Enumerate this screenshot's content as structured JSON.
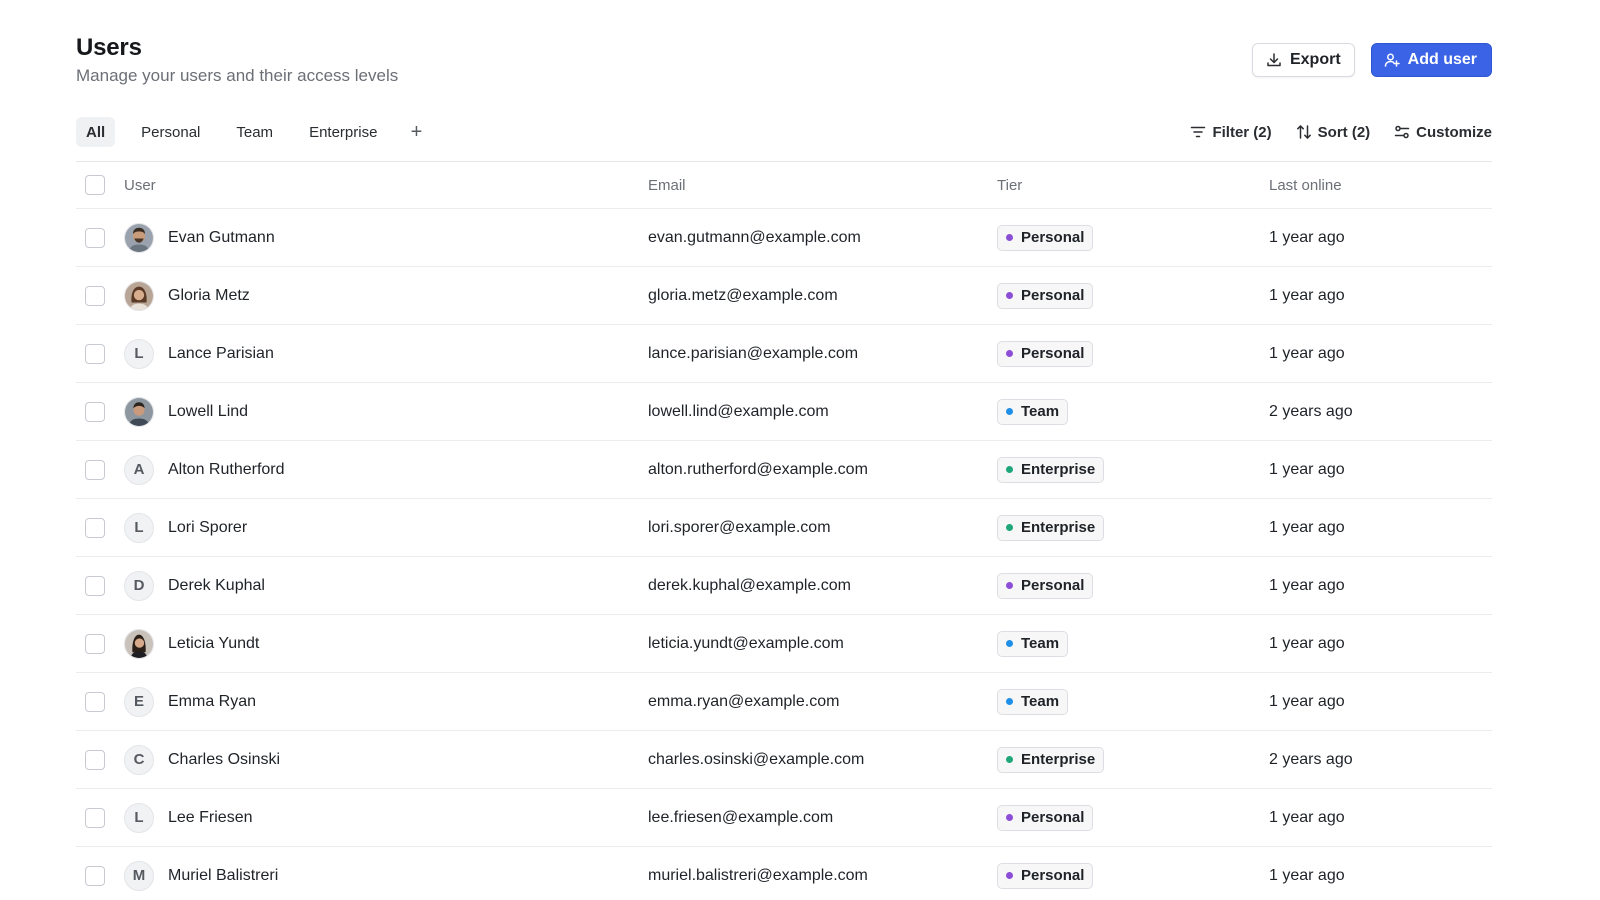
{
  "header": {
    "title": "Users",
    "subtitle": "Manage your users and their access levels",
    "export_label": "Export",
    "add_user_label": "Add user"
  },
  "tabs": [
    {
      "label": "All",
      "active": true
    },
    {
      "label": "Personal",
      "active": false
    },
    {
      "label": "Team",
      "active": false
    },
    {
      "label": "Enterprise",
      "active": false
    }
  ],
  "tab_add_label": "+",
  "tools": {
    "filter_label": "Filter (2)",
    "sort_label": "Sort (2)",
    "customize_label": "Customize"
  },
  "columns": {
    "user": "User",
    "email": "Email",
    "tier": "Tier",
    "last_online": "Last online"
  },
  "tier_colors": {
    "Personal": "#8b4fd6",
    "Team": "#1f8fe8",
    "Enterprise": "#1fa67a"
  },
  "accent_color": "#3a63e6",
  "users": [
    {
      "name": "Evan Gutmann",
      "email": "evan.gutmann@example.com",
      "tier": "Personal",
      "last_online": "1 year ago",
      "avatar": "photo",
      "initial": ""
    },
    {
      "name": "Gloria Metz",
      "email": "gloria.metz@example.com",
      "tier": "Personal",
      "last_online": "1 year ago",
      "avatar": "photo",
      "initial": ""
    },
    {
      "name": "Lance Parisian",
      "email": "lance.parisian@example.com",
      "tier": "Personal",
      "last_online": "1 year ago",
      "avatar": "initial",
      "initial": "L"
    },
    {
      "name": "Lowell Lind",
      "email": "lowell.lind@example.com",
      "tier": "Team",
      "last_online": "2 years ago",
      "avatar": "photo",
      "initial": ""
    },
    {
      "name": "Alton Rutherford",
      "email": "alton.rutherford@example.com",
      "tier": "Enterprise",
      "last_online": "1 year ago",
      "avatar": "initial",
      "initial": "A"
    },
    {
      "name": "Lori Sporer",
      "email": "lori.sporer@example.com",
      "tier": "Enterprise",
      "last_online": "1 year ago",
      "avatar": "initial",
      "initial": "L"
    },
    {
      "name": "Derek Kuphal",
      "email": "derek.kuphal@example.com",
      "tier": "Personal",
      "last_online": "1 year ago",
      "avatar": "initial",
      "initial": "D"
    },
    {
      "name": "Leticia Yundt",
      "email": "leticia.yundt@example.com",
      "tier": "Team",
      "last_online": "1 year ago",
      "avatar": "photo",
      "initial": ""
    },
    {
      "name": "Emma Ryan",
      "email": "emma.ryan@example.com",
      "tier": "Team",
      "last_online": "1 year ago",
      "avatar": "initial",
      "initial": "E"
    },
    {
      "name": "Charles Osinski",
      "email": "charles.osinski@example.com",
      "tier": "Enterprise",
      "last_online": "2 years ago",
      "avatar": "initial",
      "initial": "C"
    },
    {
      "name": "Lee Friesen",
      "email": "lee.friesen@example.com",
      "tier": "Personal",
      "last_online": "1 year ago",
      "avatar": "initial",
      "initial": "L"
    },
    {
      "name": "Muriel Balistreri",
      "email": "muriel.balistreri@example.com",
      "tier": "Personal",
      "last_online": "1 year ago",
      "avatar": "initial",
      "initial": "M"
    }
  ]
}
